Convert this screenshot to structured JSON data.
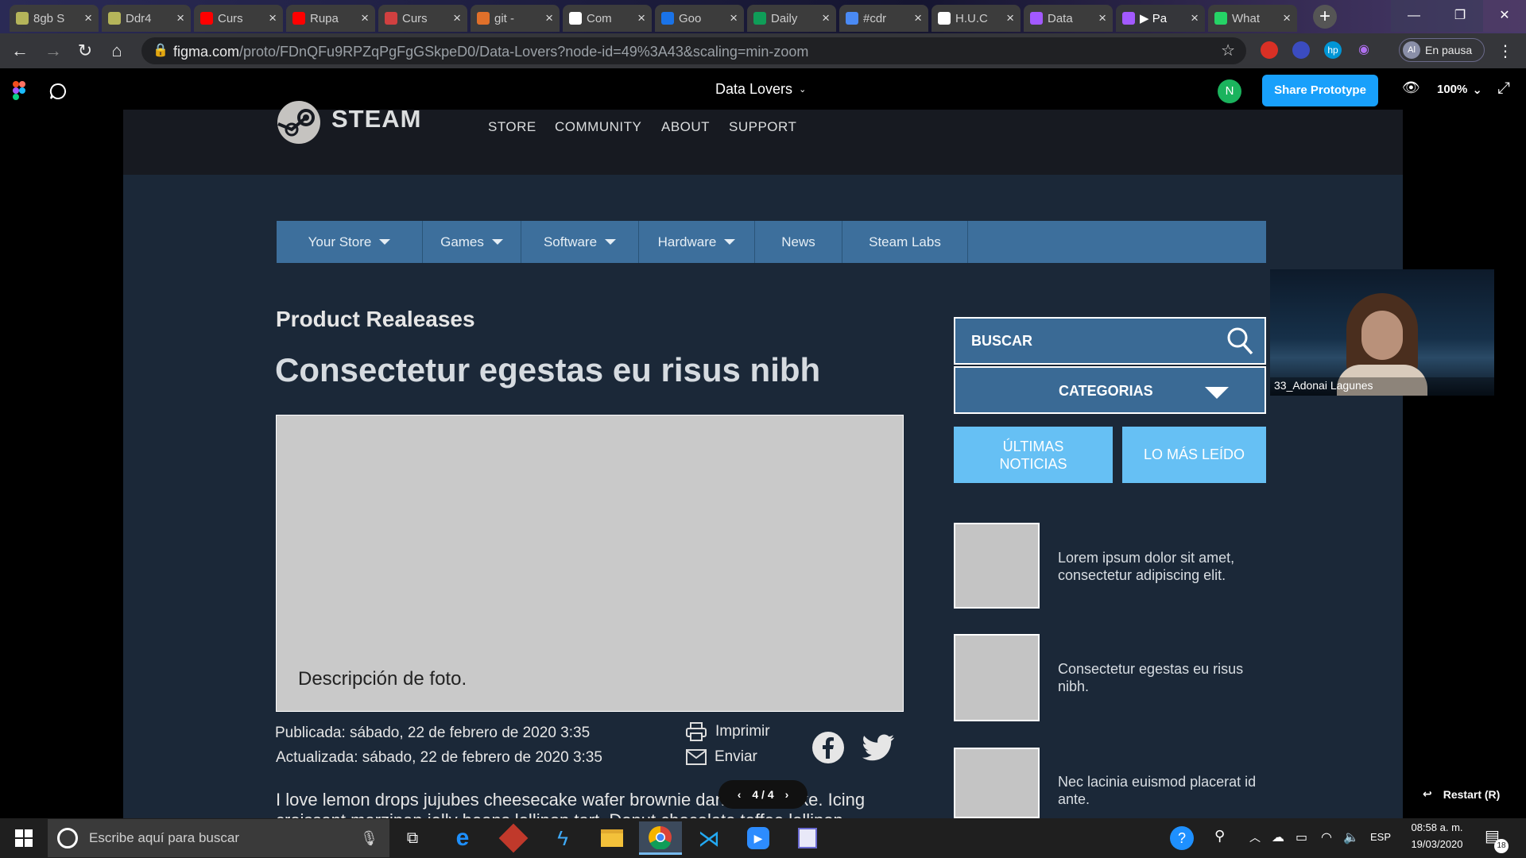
{
  "browser": {
    "tabs": [
      {
        "label": "8gb S",
        "color": "#b5b55a"
      },
      {
        "label": "Ddr4",
        "color": "#b5b55a"
      },
      {
        "label": "Curs",
        "color": "#ff0000"
      },
      {
        "label": "Rupa",
        "color": "#ff0000"
      },
      {
        "label": "Curs",
        "color": "#d04040"
      },
      {
        "label": "git -",
        "color": "#e0702a"
      },
      {
        "label": "Com",
        "color": "#ffffff"
      },
      {
        "label": "Goo",
        "color": "#1a73e8"
      },
      {
        "label": "Daily",
        "color": "#0f9d58"
      },
      {
        "label": "#cdr",
        "color": "#4a8af4"
      },
      {
        "label": "H.U.C",
        "color": "#ffffff"
      },
      {
        "label": "Data",
        "color": "#a259ff"
      },
      {
        "label": "▶ Pa",
        "color": "#a259ff"
      },
      {
        "label": "What",
        "color": "#25d366"
      }
    ],
    "url_main": "figma.com",
    "url_rest": "/proto/FDnQFu9RPZqPgFgGSkpeD0/Data-Lovers?node-id=49%3A43&scaling=min-zoom",
    "profile_initials": "Al",
    "profile_status": "En pausa"
  },
  "figma": {
    "file_title": "Data Lovers",
    "user_initial": "N",
    "share_label": "Share Prototype",
    "zoom": "100%",
    "page_indicator": "4 / 4",
    "restart_label": "Restart (R)"
  },
  "steam": {
    "logo_text": "STEAM",
    "nav": [
      "STORE",
      "COMMUNITY",
      "ABOUT",
      "SUPPORT"
    ],
    "store_menu": [
      {
        "label": "Your Store",
        "caret": true
      },
      {
        "label": "Games",
        "caret": true
      },
      {
        "label": "Software",
        "caret": true
      },
      {
        "label": "Hardware",
        "caret": true
      },
      {
        "label": "News",
        "caret": false
      },
      {
        "label": "Steam Labs",
        "caret": false
      }
    ],
    "section_title": "Product Realeases",
    "headline": "Consectetur egestas eu risus nibh",
    "photo_caption": "Descripción de foto.",
    "published": "Publicada: sábado, 22 de febrero de 2020 3:35",
    "updated": "Actualizada: sábado, 22 de febrero de 2020 3:35",
    "print_label": "Imprimir",
    "send_label": "Enviar",
    "body_line1": "I love lemon drops jujubes cheesecake wafer brownie danish oat cake. Icing",
    "body_line2": "croissant marzipan jelly beans lollipop tart. Donut chocolate toffee lollipop",
    "search_label": "BUSCAR",
    "categories_label": "CATEGORIAS",
    "tab_latest": "ÚLTIMAS NOTICIAS",
    "tab_most_read": "LO MÁS LEÍDO",
    "side_items": [
      "Lorem ipsum dolor sit amet, consectetur adipiscing elit.",
      "Consectetur egestas eu risus nibh.",
      "Nec lacinia euismod placerat id ante."
    ]
  },
  "video_overlay": {
    "name": "33_Adonai Lagunes"
  },
  "taskbar": {
    "search_placeholder": "Escribe aquí para buscar",
    "language": "ESP",
    "time": "08:58 a. m.",
    "date": "19/03/2020",
    "notification_count": "18"
  },
  "colors": {
    "steam_header": "#171a21",
    "steam_body": "#1b2838",
    "store_bar": "#3d6f9c",
    "search_box": "#3a6a95",
    "tab_button": "#66c0f4",
    "share_button": "#18a0fb"
  }
}
